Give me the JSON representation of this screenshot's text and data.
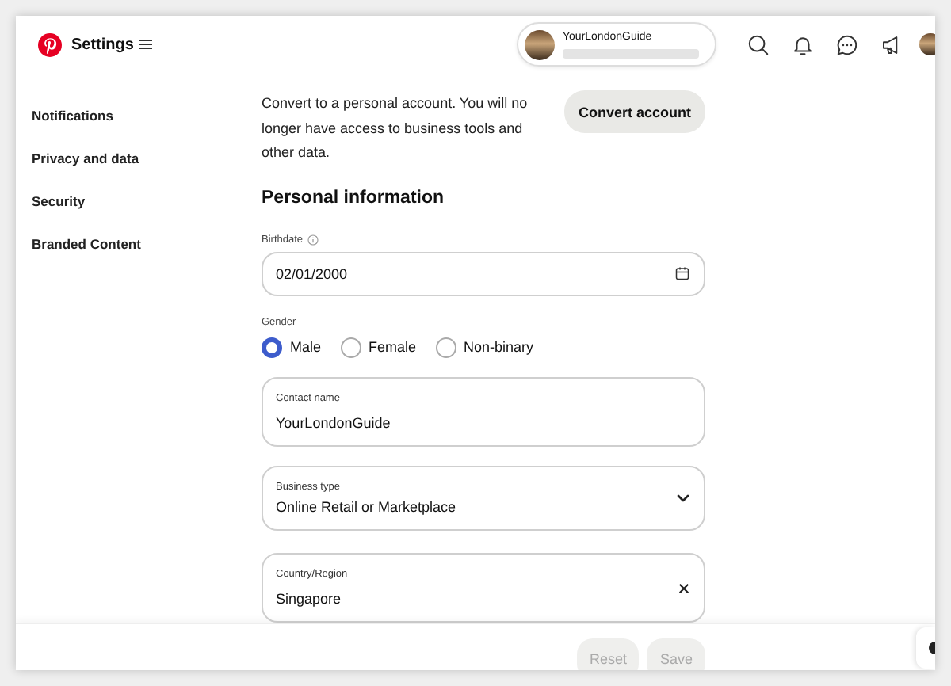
{
  "header": {
    "title": "Settings",
    "account": {
      "name": "YourLondonGuide"
    }
  },
  "sidebar": {
    "items": [
      {
        "label": "Notifications",
        "selected": false
      },
      {
        "label": "Privacy and data",
        "selected": false
      },
      {
        "label": "Security",
        "selected": false
      },
      {
        "label": "Branded Content",
        "selected": false
      }
    ]
  },
  "convert": {
    "description": "Convert to a personal account. You will no longer have access to business tools and other data.",
    "button": "Convert account"
  },
  "personal_information": {
    "heading": "Personal information",
    "birthdate": {
      "label": "Birthdate",
      "value": "02/01/2000"
    },
    "gender": {
      "label": "Gender",
      "options": [
        {
          "label": "Male",
          "selected": true
        },
        {
          "label": "Female",
          "selected": false
        },
        {
          "label": "Non-binary",
          "selected": false
        }
      ]
    },
    "fields": [
      {
        "kind": "text",
        "label": "Contact name",
        "value": "YourLondonGuide"
      },
      {
        "kind": "select",
        "label": "Business type",
        "value": "Online Retail or Marketplace"
      },
      {
        "kind": "clearable",
        "label": "Country/Region",
        "value": "Singapore"
      }
    ]
  },
  "footer": {
    "buttons": [
      {
        "label": "Reset",
        "disabled": true
      },
      {
        "label": "Save",
        "disabled": true
      }
    ]
  }
}
